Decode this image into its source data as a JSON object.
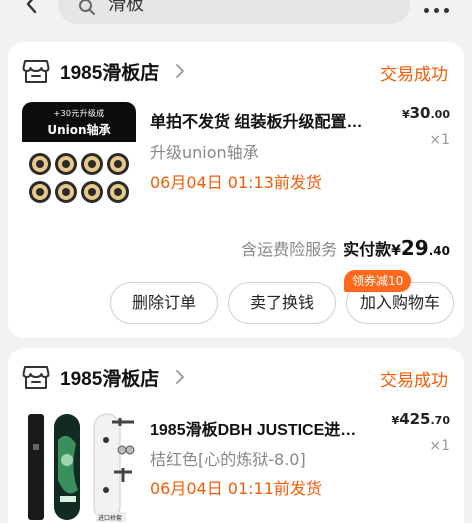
{
  "search": {
    "query": "滑板"
  },
  "orders": [
    {
      "store": "1985滑板店",
      "status": "交易成功",
      "thumb_banner_top": "+30元升级成",
      "thumb_banner_main": "Union轴承",
      "title": "单拍不发货 组装板升级配置…",
      "spec": "升级union轴承",
      "ship": "06月04日 01:13前发货",
      "price_symbol": "¥",
      "price_int": "30",
      "price_dec": ".00",
      "qty": "×1",
      "insurance": "含运费险服务",
      "paid_label": "实付款",
      "paid_symbol": "¥",
      "paid_int": "29",
      "paid_dec": ".40",
      "buttons": {
        "delete": "删除订单",
        "resell": "卖了换钱",
        "cart": "加入购物车"
      },
      "coupon": "领券减10"
    },
    {
      "store": "1985滑板店",
      "status": "交易成功",
      "title": "1985滑板DBH JUSTICE进…",
      "spec": "桔红色[心的炼狱-8.0]",
      "ship": "06月04日 01:11前发货",
      "price_symbol": "¥",
      "price_int": "425",
      "price_dec": ".70",
      "qty": "×1",
      "thumb_tag": "进口桥套"
    }
  ],
  "colors": {
    "accent": "#f25c05",
    "coupon_bg": "#ff6a1a",
    "background": "#f2f2f2"
  },
  "icons": [
    "back-arrow-icon",
    "search-icon",
    "more-icon",
    "store-icon",
    "chevron-right-icon"
  ]
}
